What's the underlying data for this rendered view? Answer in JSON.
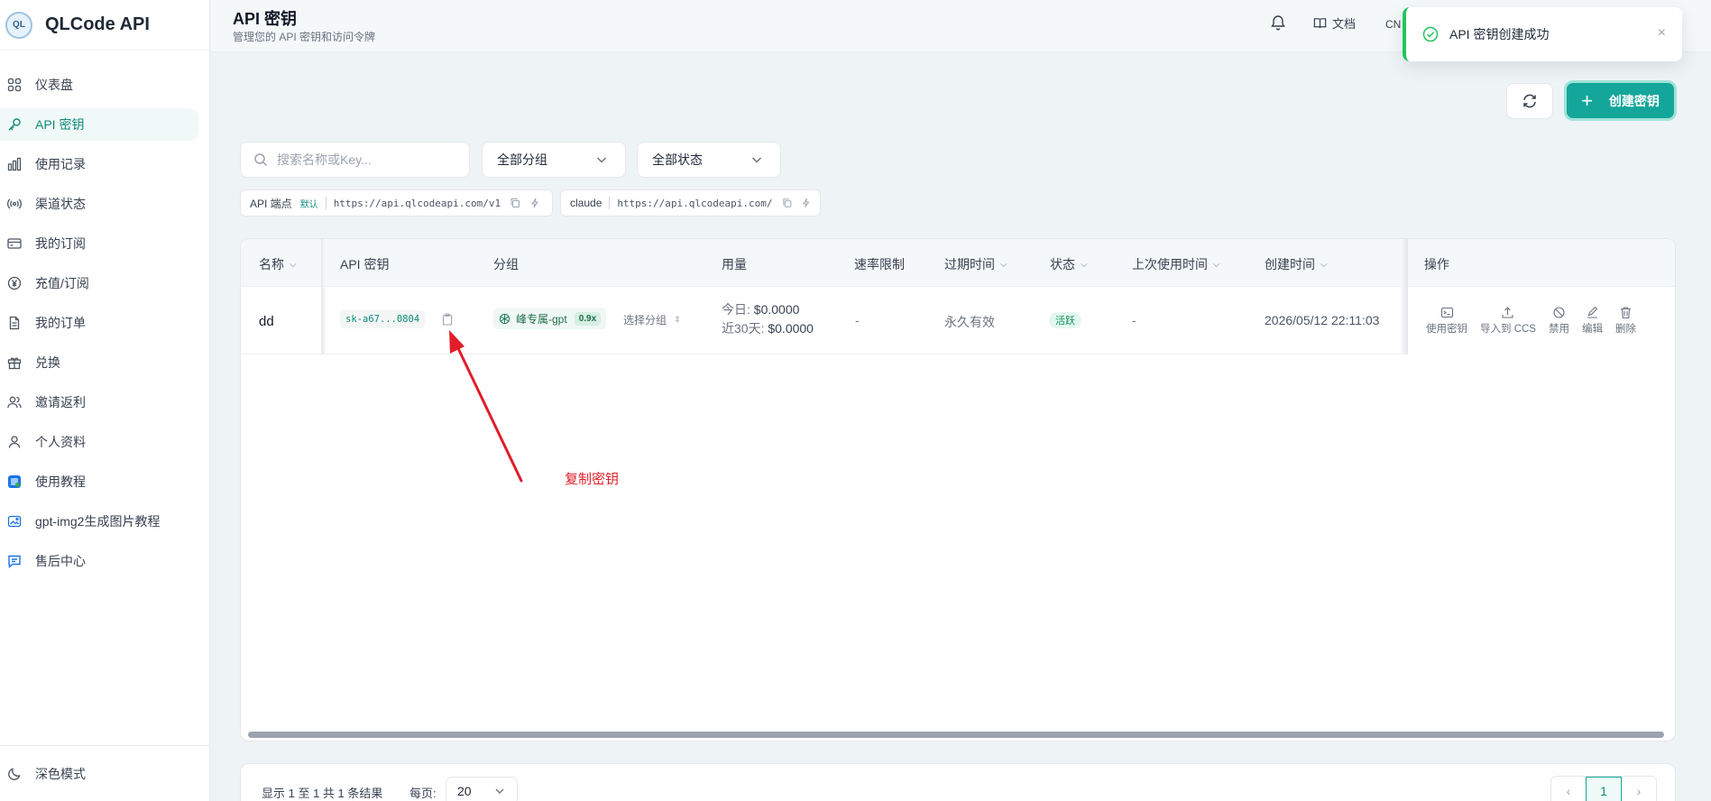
{
  "brand": {
    "name": "QLCode API",
    "logo_text": "QL"
  },
  "sidebar": {
    "items": [
      {
        "label": "仪表盘",
        "icon": "grid-icon"
      },
      {
        "label": "API 密钥",
        "icon": "key-icon",
        "active": true
      },
      {
        "label": "使用记录",
        "icon": "bar-chart-icon"
      },
      {
        "label": "渠道状态",
        "icon": "broadcast-icon"
      },
      {
        "label": "我的订阅",
        "icon": "card-icon"
      },
      {
        "label": "充值/订阅",
        "icon": "yen-circle-icon"
      },
      {
        "label": "我的订单",
        "icon": "document-icon"
      },
      {
        "label": "兑换",
        "icon": "gift-icon"
      },
      {
        "label": "邀请返利",
        "icon": "users-icon"
      },
      {
        "label": "个人资料",
        "icon": "user-icon"
      },
      {
        "label": "使用教程",
        "icon": "tutorial-icon"
      },
      {
        "label": "gpt-img2生成图片教程",
        "icon": "image-icon"
      },
      {
        "label": "售后中心",
        "icon": "chat-icon"
      }
    ],
    "dark_mode_label": "深色模式"
  },
  "header": {
    "title": "API 密钥",
    "subtitle": "管理您的 API 密钥和访问令牌",
    "docs_label": "文档",
    "lang_label": "CN"
  },
  "toast": {
    "message": "API 密钥创建成功",
    "close": "×"
  },
  "actions": {
    "create_label": "创建密钥",
    "create_plus": "+"
  },
  "filters": {
    "search_placeholder": "搜索名称或Key...",
    "group_select": "全部分组",
    "status_select": "全部状态"
  },
  "endpoints": [
    {
      "label": "API 端点",
      "badge": "默认",
      "url": "https://api.qlcodeapi.com/v1"
    },
    {
      "label": "claude",
      "badge": "",
      "url": "https://api.qlcodeapi.com/"
    }
  ],
  "table": {
    "headers": {
      "name": "名称",
      "key": "API 密钥",
      "group": "分组",
      "usage": "用量",
      "rate_limit": "速率限制",
      "expires": "过期时间",
      "status": "状态",
      "last_used": "上次使用时间",
      "created": "创建时间",
      "ops": "操作"
    },
    "rows": [
      {
        "name": "dd",
        "key": "sk-a67...0804",
        "group": "峰专属-gpt",
        "ratio": "0.9x",
        "pick_group": "选择分组",
        "usage_today_label": "今日:",
        "usage_today": "$0.0000",
        "usage_30d_label": "近30天:",
        "usage_30d": "$0.0000",
        "rate_limit": "-",
        "expires": "永久有效",
        "status": "活跃",
        "last_used": "-",
        "created": "2026/05/12 22:11:03",
        "ops": {
          "use_key": "使用密钥",
          "import_ccs": "导入到 CCS",
          "disable": "禁用",
          "edit": "编辑",
          "delete": "删除"
        }
      }
    ]
  },
  "pagination": {
    "summary": "显示 1 至 1 共 1 条结果",
    "per_page_label": "每页:",
    "page_size": "20",
    "current_page": "1"
  },
  "annotation": {
    "text": "复制密钥",
    "color": "#e11d2a"
  },
  "colors": {
    "accent": "#14a69a",
    "success": "#22c55e",
    "annotation": "#e11d2a"
  }
}
